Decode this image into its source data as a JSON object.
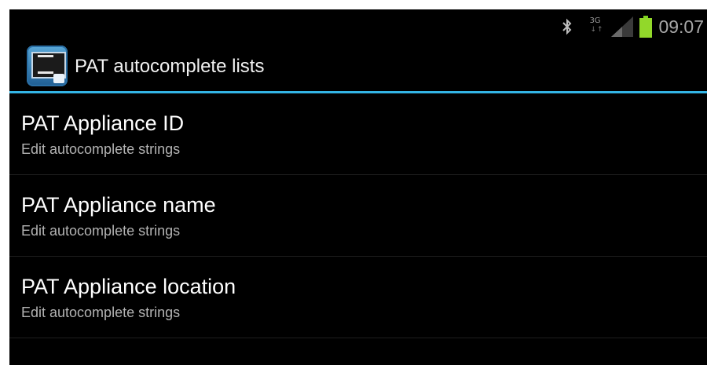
{
  "status_bar": {
    "network_type": "3G",
    "clock": "09:07",
    "icons": [
      "bluetooth-icon",
      "network-3g-icon",
      "signal-icon",
      "battery-icon"
    ],
    "battery_color": "#92d82a"
  },
  "action_bar": {
    "title": "PAT autocomplete lists",
    "accent_color": "#33b5e5"
  },
  "preferences": [
    {
      "title": "PAT Appliance ID",
      "summary": "Edit autocomplete strings"
    },
    {
      "title": "PAT Appliance name",
      "summary": "Edit autocomplete strings"
    },
    {
      "title": "PAT Appliance location",
      "summary": "Edit autocomplete strings"
    }
  ]
}
